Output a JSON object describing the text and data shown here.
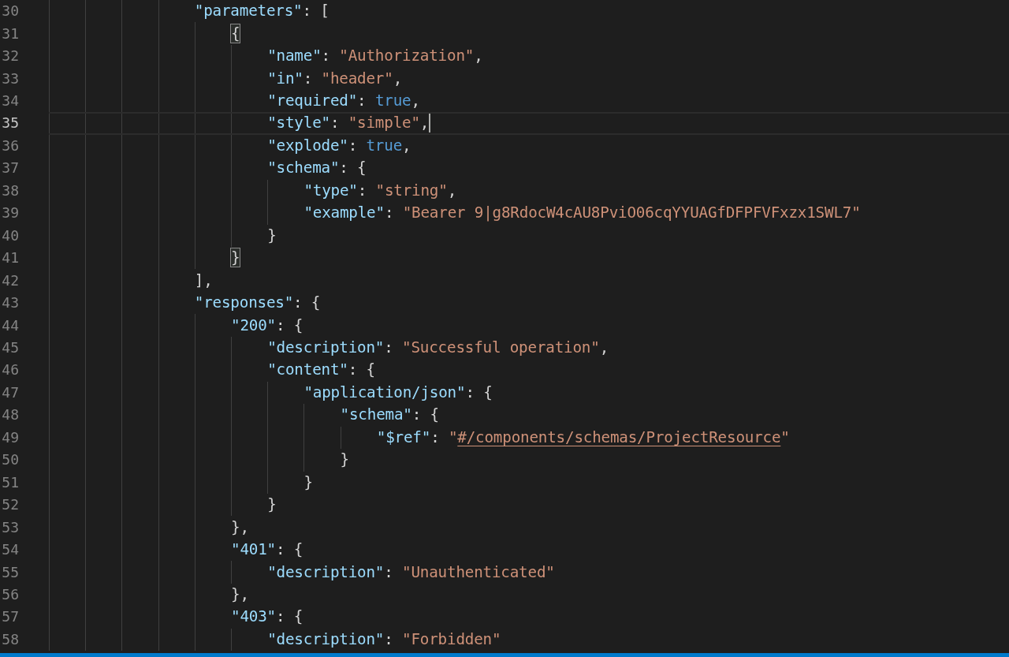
{
  "editor": {
    "lines": [
      {
        "number": "30",
        "tokens": [
          {
            "kind": "key",
            "text": "\"parameters\""
          },
          {
            "kind": "punct",
            "text": ": ["
          }
        ],
        "children": [
          {
            "number": "31",
            "tokens": [
              {
                "kind": "punct",
                "text": "{",
                "bracket_match": true
              }
            ],
            "children": [
              {
                "number": "32",
                "tokens": [
                  {
                    "kind": "key",
                    "text": "\"name\""
                  },
                  {
                    "kind": "punct",
                    "text": ": "
                  },
                  {
                    "kind": "string",
                    "text": "\"Authorization\""
                  },
                  {
                    "kind": "punct",
                    "text": ","
                  }
                ]
              },
              {
                "number": "33",
                "tokens": [
                  {
                    "kind": "key",
                    "text": "\"in\""
                  },
                  {
                    "kind": "punct",
                    "text": ": "
                  },
                  {
                    "kind": "string",
                    "text": "\"header\""
                  },
                  {
                    "kind": "punct",
                    "text": ","
                  }
                ]
              },
              {
                "number": "34",
                "tokens": [
                  {
                    "kind": "key",
                    "text": "\"required\""
                  },
                  {
                    "kind": "punct",
                    "text": ": "
                  },
                  {
                    "kind": "bool",
                    "text": "true"
                  },
                  {
                    "kind": "punct",
                    "text": ","
                  }
                ]
              },
              {
                "number": "35",
                "current": true,
                "tokens": [
                  {
                    "kind": "key",
                    "text": "\"style\""
                  },
                  {
                    "kind": "punct",
                    "text": ": "
                  },
                  {
                    "kind": "string",
                    "text": "\"simple\""
                  },
                  {
                    "kind": "punct",
                    "text": ","
                  }
                ]
              },
              {
                "number": "36",
                "tokens": [
                  {
                    "kind": "key",
                    "text": "\"explode\""
                  },
                  {
                    "kind": "punct",
                    "text": ": "
                  },
                  {
                    "kind": "bool",
                    "text": "true"
                  },
                  {
                    "kind": "punct",
                    "text": ","
                  }
                ]
              },
              {
                "number": "37",
                "tokens": [
                  {
                    "kind": "key",
                    "text": "\"schema\""
                  },
                  {
                    "kind": "punct",
                    "text": ": {"
                  }
                ],
                "children": [
                  {
                    "number": "38",
                    "tokens": [
                      {
                        "kind": "key",
                        "text": "\"type\""
                      },
                      {
                        "kind": "punct",
                        "text": ": "
                      },
                      {
                        "kind": "string",
                        "text": "\"string\""
                      },
                      {
                        "kind": "punct",
                        "text": ","
                      }
                    ]
                  },
                  {
                    "number": "39",
                    "tokens": [
                      {
                        "kind": "key",
                        "text": "\"example\""
                      },
                      {
                        "kind": "punct",
                        "text": ": "
                      },
                      {
                        "kind": "string",
                        "text": "\"Bearer 9|g8RdocW4cAU8PviO06cqYYUAGfDFPFVFxzx1SWL7\""
                      }
                    ]
                  }
                ]
              },
              {
                "number": "40",
                "tokens": [
                  {
                    "kind": "punct",
                    "text": "}"
                  }
                ]
              }
            ]
          },
          {
            "number": "41",
            "tokens": [
              {
                "kind": "punct",
                "text": "}",
                "bracket_match": true
              }
            ]
          }
        ]
      },
      {
        "number": "42",
        "tokens": [
          {
            "kind": "punct",
            "text": "],"
          }
        ]
      },
      {
        "number": "43",
        "tokens": [
          {
            "kind": "key",
            "text": "\"responses\""
          },
          {
            "kind": "punct",
            "text": ": {"
          }
        ],
        "children": [
          {
            "number": "44",
            "tokens": [
              {
                "kind": "key",
                "text": "\"200\""
              },
              {
                "kind": "punct",
                "text": ": {"
              }
            ],
            "children": [
              {
                "number": "45",
                "tokens": [
                  {
                    "kind": "key",
                    "text": "\"description\""
                  },
                  {
                    "kind": "punct",
                    "text": ": "
                  },
                  {
                    "kind": "string",
                    "text": "\"Successful operation\""
                  },
                  {
                    "kind": "punct",
                    "text": ","
                  }
                ]
              },
              {
                "number": "46",
                "tokens": [
                  {
                    "kind": "key",
                    "text": "\"content\""
                  },
                  {
                    "kind": "punct",
                    "text": ": {"
                  }
                ],
                "children": [
                  {
                    "number": "47",
                    "tokens": [
                      {
                        "kind": "key",
                        "text": "\"application/json\""
                      },
                      {
                        "kind": "punct",
                        "text": ": {"
                      }
                    ],
                    "children": [
                      {
                        "number": "48",
                        "tokens": [
                          {
                            "kind": "key",
                            "text": "\"schema\""
                          },
                          {
                            "kind": "punct",
                            "text": ": {"
                          }
                        ],
                        "children": [
                          {
                            "number": "49",
                            "tokens": [
                              {
                                "kind": "key",
                                "text": "\"$ref\""
                              },
                              {
                                "kind": "punct",
                                "text": ": "
                              },
                              {
                                "kind": "string",
                                "text": "\""
                              },
                              {
                                "kind": "string",
                                "text": "#/components/schemas/ProjectResource",
                                "link": true
                              },
                              {
                                "kind": "string",
                                "text": "\""
                              }
                            ]
                          }
                        ]
                      },
                      {
                        "number": "50",
                        "tokens": [
                          {
                            "kind": "punct",
                            "text": "}"
                          }
                        ]
                      }
                    ]
                  },
                  {
                    "number": "51",
                    "tokens": [
                      {
                        "kind": "punct",
                        "text": "}"
                      }
                    ]
                  }
                ]
              },
              {
                "number": "52",
                "tokens": [
                  {
                    "kind": "punct",
                    "text": "}"
                  }
                ]
              }
            ]
          },
          {
            "number": "53",
            "tokens": [
              {
                "kind": "punct",
                "text": "},"
              }
            ]
          },
          {
            "number": "54",
            "tokens": [
              {
                "kind": "key",
                "text": "\"401\""
              },
              {
                "kind": "punct",
                "text": ": {"
              }
            ],
            "children": [
              {
                "number": "55",
                "tokens": [
                  {
                    "kind": "key",
                    "text": "\"description\""
                  },
                  {
                    "kind": "punct",
                    "text": ": "
                  },
                  {
                    "kind": "string",
                    "text": "\"Unauthenticated\""
                  }
                ]
              }
            ]
          },
          {
            "number": "56",
            "tokens": [
              {
                "kind": "punct",
                "text": "},"
              }
            ]
          },
          {
            "number": "57",
            "tokens": [
              {
                "kind": "key",
                "text": "\"403\""
              },
              {
                "kind": "punct",
                "text": ": {"
              }
            ],
            "children": [
              {
                "number": "58",
                "tokens": [
                  {
                    "kind": "key",
                    "text": "\"description\""
                  },
                  {
                    "kind": "punct",
                    "text": ": "
                  },
                  {
                    "kind": "string",
                    "text": "\"Forbidden\""
                  }
                ]
              }
            ]
          }
        ]
      }
    ]
  }
}
